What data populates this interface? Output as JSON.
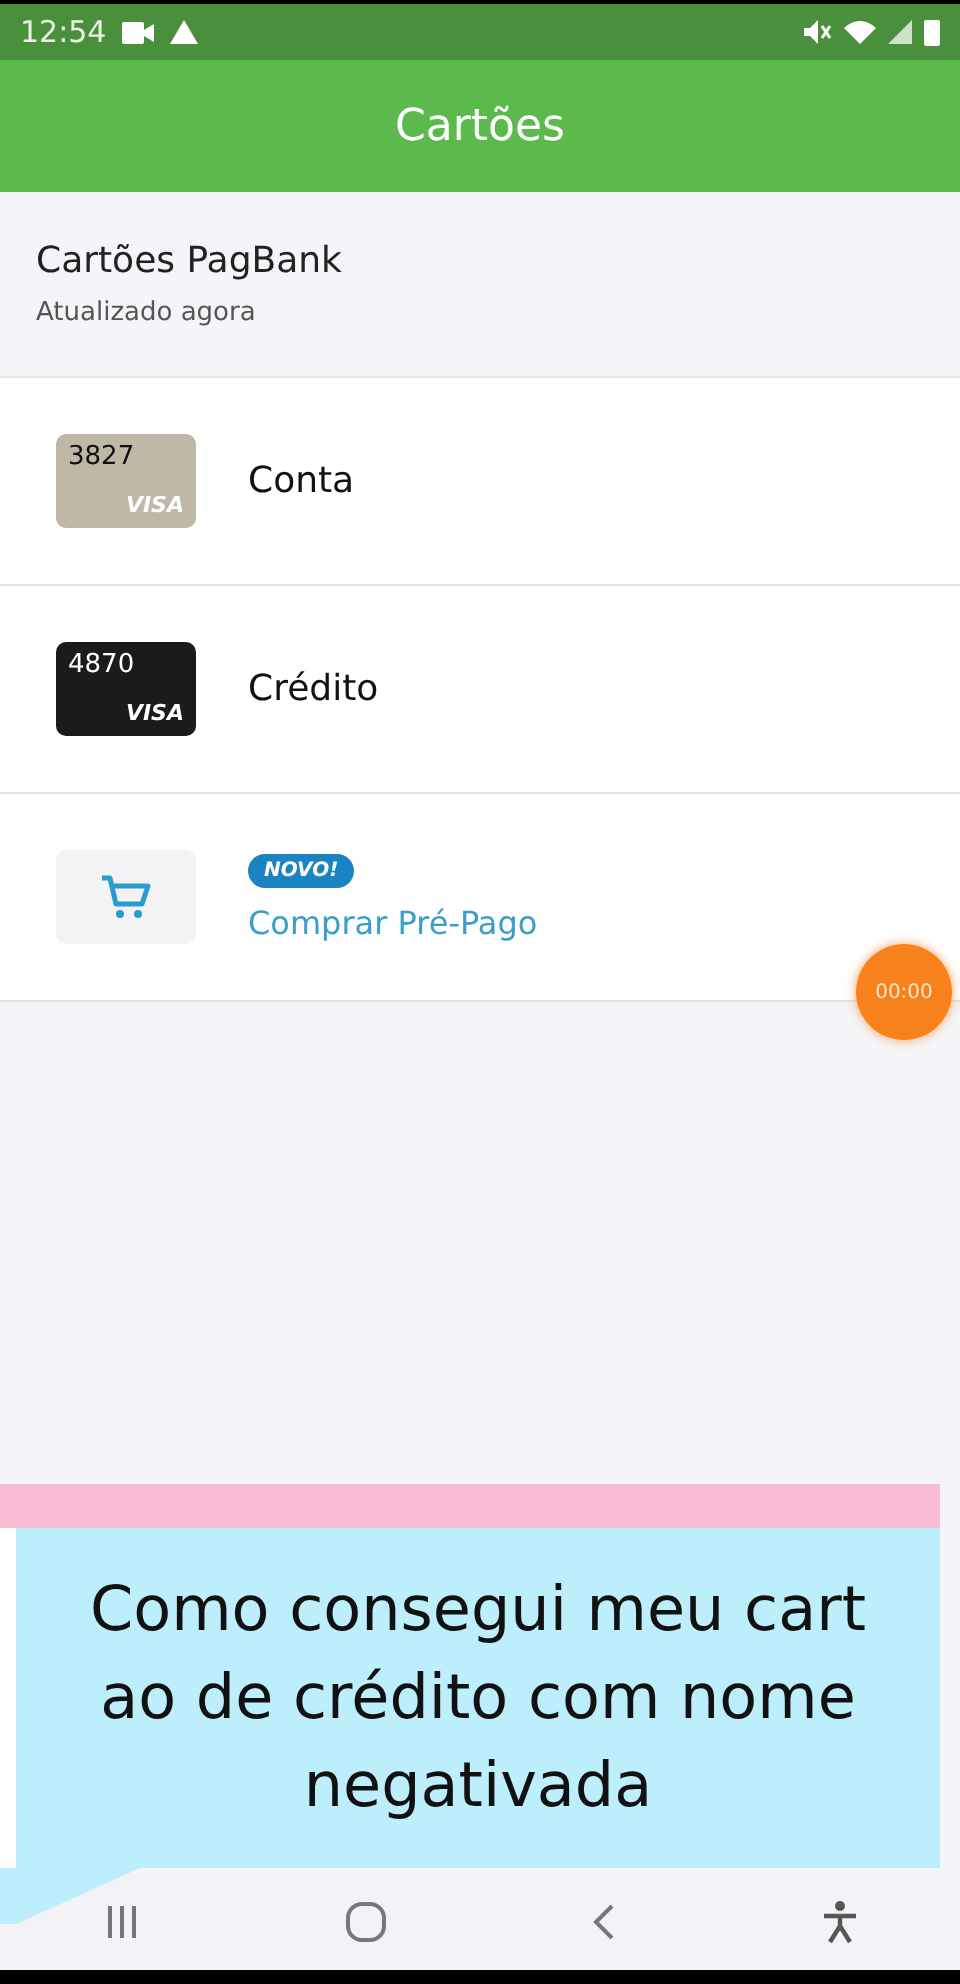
{
  "status_bar": {
    "time": "12:54"
  },
  "app_bar": {
    "title": "Cartões"
  },
  "header": {
    "title": "Cartões PagBank",
    "subtitle": "Atualizado agora"
  },
  "items": [
    {
      "kind": "card",
      "number": "3827",
      "brand": "VISA",
      "color": "#bfb8a6",
      "label": "Conta"
    },
    {
      "kind": "card",
      "number": "4870",
      "brand": "VISA",
      "color": "#1c1a1b",
      "label": "Crédito"
    },
    {
      "kind": "action",
      "badge": "NOVO!",
      "label": "Comprar Pré-Pago"
    }
  ],
  "timer": {
    "label": "00:00"
  },
  "caption": {
    "lines": [
      "Como consegui meu cart",
      "ao de crédito com nome",
      "negativada"
    ]
  }
}
